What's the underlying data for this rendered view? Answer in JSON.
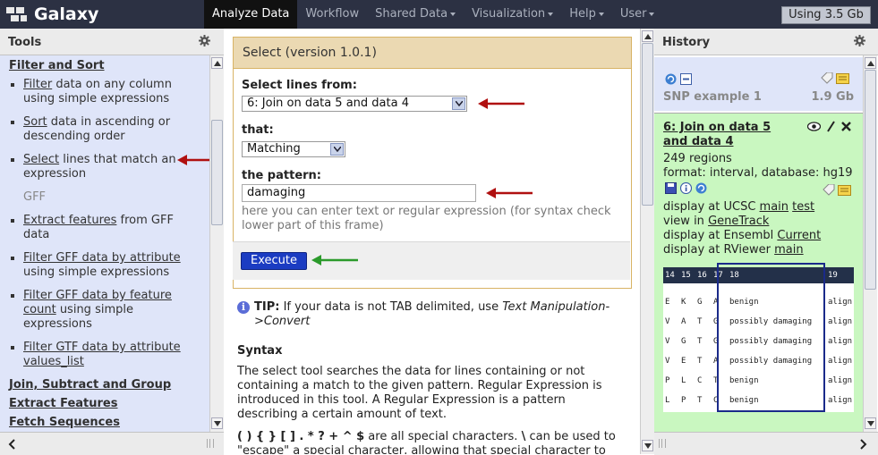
{
  "masthead": {
    "brand": "Galaxy",
    "nav": [
      {
        "label": "Analyze Data",
        "active": true,
        "dropdown": false
      },
      {
        "label": "Workflow",
        "active": false,
        "dropdown": false
      },
      {
        "label": "Shared Data",
        "active": false,
        "dropdown": true
      },
      {
        "label": "Visualization",
        "active": false,
        "dropdown": true
      },
      {
        "label": "Help",
        "active": false,
        "dropdown": true
      },
      {
        "label": "User",
        "active": false,
        "dropdown": true
      }
    ],
    "quota": "Using 3.5 Gb"
  },
  "tools": {
    "title": "Tools",
    "sections": {
      "filter_sort": "Filter and Sort",
      "join": "Join, Subtract and Group",
      "extract": "Extract Features",
      "fetch": "Fetch Sequences"
    },
    "items": [
      {
        "link": "Filter",
        "rest": " data on any column using simple expressions"
      },
      {
        "link": "Sort",
        "rest": " data in ascending or descending order"
      },
      {
        "link": "Select",
        "rest": " lines that match an expression"
      },
      {
        "link": "Extract features",
        "rest": " from GFF data"
      },
      {
        "link": "Filter GFF data by attribute",
        "rest": " using simple expressions"
      },
      {
        "link": "Filter GFF data by feature count",
        "rest": " using simple expressions"
      },
      {
        "link": "Filter GTF data by attribute values_list",
        "rest": ""
      }
    ],
    "gff_label": "GFF"
  },
  "form": {
    "title": "Select (version 1.0.1)",
    "select_lines_label": "Select lines from:",
    "select_lines_value": "6: Join on data 5 and data 4",
    "that_label": "that:",
    "that_value": "Matching",
    "pattern_label": "the pattern:",
    "pattern_value": "damaging",
    "pattern_help": "here you can enter text or regular expression (for syntax check lower part of this frame)",
    "execute": "Execute",
    "tip_label": "TIP:",
    "tip_text_a": " If your data is not TAB delimited, use ",
    "tip_text_b": "Text Manipulation->Convert",
    "syntax_heading": "Syntax",
    "syntax_text": "The select tool searches the data for lines containing or not containing a match to the given pattern. Regular Expression is introduced in this tool. A Regular Expression is a pattern describing a certain amount of text.",
    "special_chars": "( ) { } [ ] . * ? + ^ $",
    "special_rest": " are all special characters. ",
    "backslash": "\\",
    "special_rest2": " can be used to \"escape\" a special character, allowing that special character to be"
  },
  "history": {
    "title": "History",
    "name": "SNP example 1",
    "size": "1.9 Gb",
    "dataset": {
      "title": "6: Join on data 5 and data 4",
      "regions": "249 regions",
      "format": "format: interval, database: hg19",
      "ucsc_prefix": "display at UCSC ",
      "ucsc_main": "main",
      "ucsc_test": "test",
      "genetrack_prefix": "view in ",
      "genetrack": "GeneTrack",
      "ensembl_prefix": "display at Ensembl ",
      "ensembl": "Current",
      "rviewer_prefix": "display at RViewer ",
      "rviewer": "main"
    },
    "peek_header": [
      "14",
      "15",
      "16",
      "17",
      "18",
      "19"
    ],
    "peek_rows": [
      [
        "E",
        "K",
        "G",
        "A",
        "benign",
        "align"
      ],
      [
        "V",
        "A",
        "T",
        "G",
        "possibly damaging",
        "align"
      ],
      [
        "V",
        "G",
        "T",
        "G",
        "possibly damaging",
        "align"
      ],
      [
        "V",
        "E",
        "T",
        "A",
        "possibly damaging",
        "align"
      ],
      [
        "P",
        "L",
        "C",
        "T",
        "benign",
        "align"
      ],
      [
        "L",
        "P",
        "T",
        "C",
        "benign",
        "align"
      ]
    ]
  },
  "colors": {
    "masthead": "#2c3143",
    "tools_bg": "#dfe5f9",
    "form_header": "#ebd9b2",
    "execute": "#1b3cc2",
    "dataset_ok": "#c9f7c0",
    "annotation_red": "#b01010",
    "annotation_green": "#2b9a2b"
  }
}
